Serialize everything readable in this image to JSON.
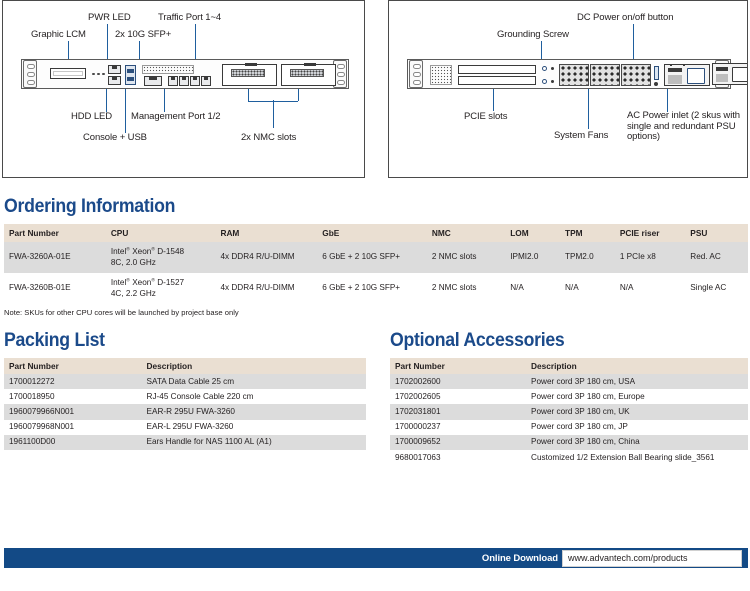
{
  "diagrams": {
    "front": {
      "panel_name": "front-panel-diagram",
      "callouts": [
        {
          "id": "graphic-lcm",
          "label": "Graphic LCM"
        },
        {
          "id": "pwr-led",
          "label": "PWR LED"
        },
        {
          "id": "sfp",
          "label": "2x 10G SFP+"
        },
        {
          "id": "traffic-port",
          "label": "Traffic Port 1~4"
        },
        {
          "id": "hdd-led",
          "label": "HDD LED"
        },
        {
          "id": "mgmt-port",
          "label": "Management Port 1/2"
        },
        {
          "id": "console-usb",
          "label": "Console + USB"
        },
        {
          "id": "nmc-slots",
          "label": "2x NMC slots"
        }
      ]
    },
    "rear": {
      "panel_name": "rear-panel-diagram",
      "callouts": [
        {
          "id": "grounding-screw",
          "label": "Grounding Screw"
        },
        {
          "id": "dc-power-button",
          "label": "DC Power on/off button"
        },
        {
          "id": "pcie-slots",
          "label": "PCIE slots"
        },
        {
          "id": "system-fans",
          "label": "System Fans"
        },
        {
          "id": "ac-power-inlet",
          "label": "AC Power inlet\n(2 skus with single and\nredundant PSU options)"
        }
      ]
    }
  },
  "ordering": {
    "title": "Ordering Information",
    "columns": [
      "Part Number",
      "CPU",
      "RAM",
      "GbE",
      "NMC",
      "LOM",
      "TPM",
      "PCIE riser",
      "PSU"
    ],
    "rows": [
      {
        "part_number": "FWA-3260A-01E",
        "cpu_line1": "Intel",
        "cpu_line1_mid": " Xeon",
        "cpu_line1_end": " D-1548",
        "cpu_line2": "8C, 2.0 GHz",
        "ram": "4x DDR4 R/U-DIMM",
        "gbe": "6 GbE + 2 10G SFP+",
        "nmc": "2 NMC slots",
        "lom": "IPMI2.0",
        "tpm": "TPM2.0",
        "pcie_riser": "1 PCIe x8",
        "psu": "Red. AC"
      },
      {
        "part_number": "FWA-3260B-01E",
        "cpu_line1": "Intel",
        "cpu_line1_mid": " Xeon",
        "cpu_line1_end": " D-1527",
        "cpu_line2": "4C, 2.2 GHz",
        "ram": "4x DDR4 R/U-DIMM",
        "gbe": "6 GbE + 2 10G SFP+",
        "nmc": "2 NMC slots",
        "lom": "N/A",
        "tpm": "N/A",
        "pcie_riser": "N/A",
        "psu": "Single AC"
      }
    ],
    "note": "Note: SKUs for other CPU cores will be launched by project base only"
  },
  "packing": {
    "title": "Packing List",
    "columns": [
      "Part Number",
      "Description"
    ],
    "rows": [
      {
        "part_number": "1700012272",
        "description": "SATA Data Cable 25 cm"
      },
      {
        "part_number": "1700018950",
        "description": "RJ-45 Console Cable 220 cm"
      },
      {
        "part_number": "1960079966N001",
        "description": "EAR-R 295U FWA-3260"
      },
      {
        "part_number": "1960079968N001",
        "description": "EAR-L 295U FWA-3260"
      },
      {
        "part_number": "1961100D00",
        "description": "Ears Handle for NAS 1100 AL (A1)"
      }
    ]
  },
  "optional": {
    "title": "Optional Accessories",
    "columns": [
      "Part Number",
      "Description"
    ],
    "rows": [
      {
        "part_number": "1702002600",
        "description": "Power cord 3P 180 cm, USA"
      },
      {
        "part_number": "1702002605",
        "description": "Power cord 3P 180 cm, Europe"
      },
      {
        "part_number": "1702031801",
        "description": "Power cord 3P 180 cm, UK"
      },
      {
        "part_number": "1700000237",
        "description": "Power cord 3P 180 cm, JP"
      },
      {
        "part_number": "1700009652",
        "description": "Power cord 3P 180 cm, China"
      },
      {
        "part_number": "9680017063",
        "description": "Customized 1/2 Extension Ball Bearing slide_3561"
      }
    ]
  },
  "footer": {
    "label": "Online Download",
    "url": "www.advantech.com/products"
  },
  "colors": {
    "heading_blue": "#1b4a8a",
    "footer_blue": "#134a86",
    "table_header_beige": "#eadfd2",
    "table_row_gray": "#dcdcdc",
    "callout_blue": "#1f5f9e"
  }
}
